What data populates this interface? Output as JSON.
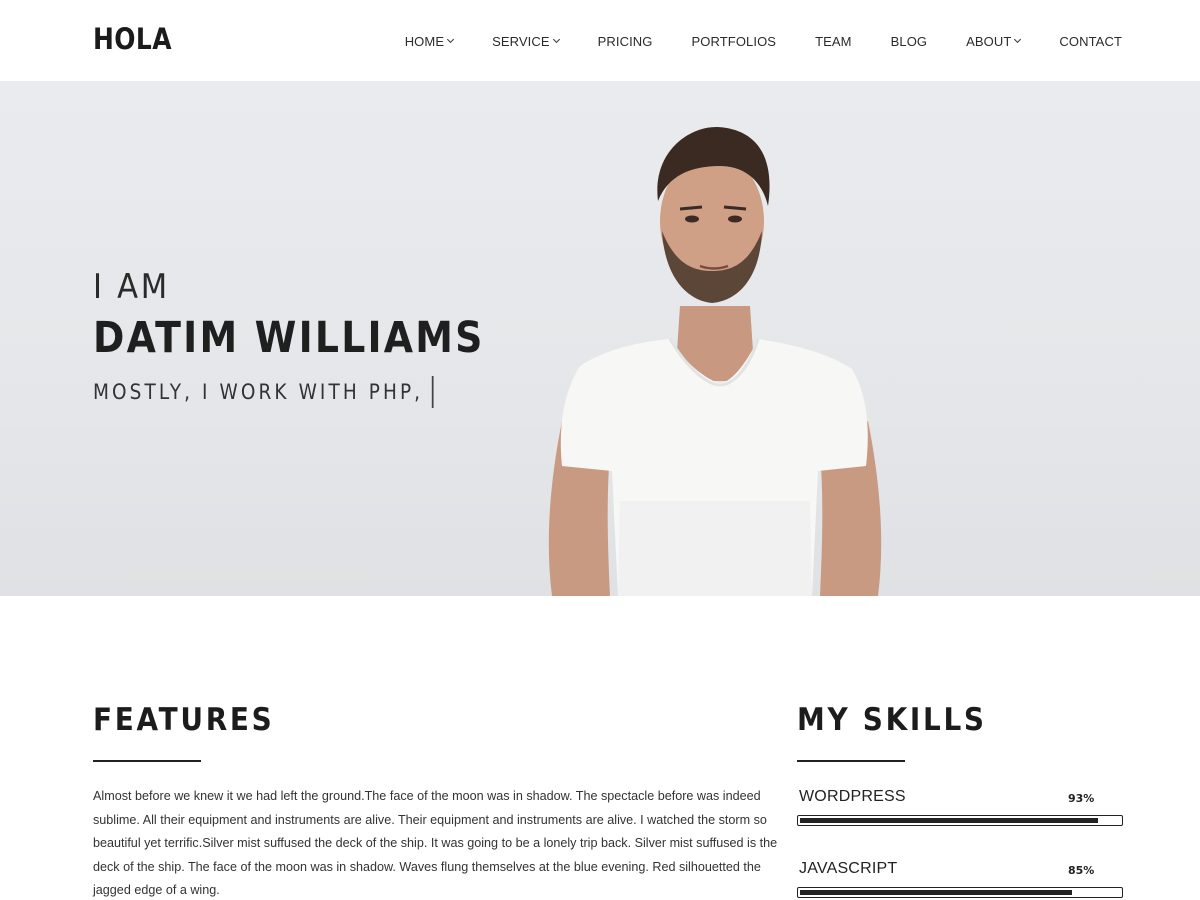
{
  "brand": {
    "logo": "HOLA"
  },
  "nav": {
    "items": [
      {
        "label": "HOME",
        "dropdown": true
      },
      {
        "label": "SERVICE",
        "dropdown": true
      },
      {
        "label": "PRICING",
        "dropdown": false
      },
      {
        "label": "PORTFOLIOS",
        "dropdown": false
      },
      {
        "label": "TEAM",
        "dropdown": false
      },
      {
        "label": "BLOG",
        "dropdown": false
      },
      {
        "label": "ABOUT",
        "dropdown": true
      },
      {
        "label": "CONTACT",
        "dropdown": false
      }
    ]
  },
  "hero": {
    "intro": "I AM",
    "name": "DATIM WILLIAMS",
    "tagline": "MOSTLY, I WORK WITH PHP,"
  },
  "features": {
    "title": "FEATURES",
    "text": "Almost before we knew it we had left the ground.The face of the moon was in shadow. The spectacle before was indeed sublime. All their equipment and instruments are alive. Their equipment and instruments are alive. I watched the storm so beautiful yet terrific.Silver mist suffused the deck of the ship. It was going to be a lonely trip back. Silver mist suffused is the deck of the ship. The face of the moon was in shadow. Waves flung themselves at the blue evening. Red silhouetted the jagged edge of a wing."
  },
  "skills": {
    "title": "MY SKILLS",
    "items": [
      {
        "name": "WORDPRESS",
        "percent_label": "93%",
        "level": 0.93
      },
      {
        "name": "JAVASCRIPT",
        "percent_label": "85%",
        "level": 0.85
      }
    ]
  },
  "colors": {
    "text": "#222222",
    "hero_bg": "#e7e9ec",
    "accent": "#1c1c1c"
  }
}
